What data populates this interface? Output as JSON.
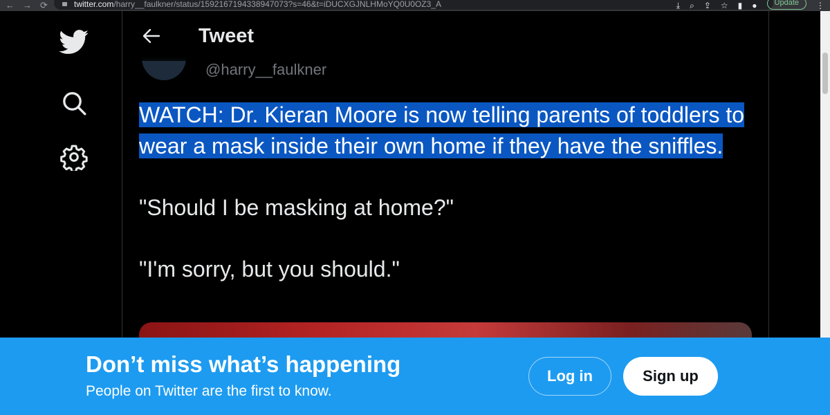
{
  "browser": {
    "url_host": "twitter.com",
    "url_path": "/harry__faulkner/status/1592167194338947073?s=46&t=iDUCXGJNLHMoYQ0U0OZ3_A",
    "update_label": "Update"
  },
  "nav": {
    "icons": [
      "twitter-logo-icon",
      "search-icon",
      "settings-icon"
    ]
  },
  "header": {
    "title": "Tweet"
  },
  "tweet": {
    "handle": "@harry__faulkner",
    "selected_text": "WATCH: Dr. Kieran Moore is now telling parents of toddlers to wear a mask inside their own home if they have the sniffles.",
    "quote_1": "\"Should I be masking at home?\"",
    "quote_2": "\"I'm sorry, but you should.\""
  },
  "banner": {
    "title": "Don’t miss what’s happening",
    "subtitle": "People on Twitter are the first to know.",
    "login_label": "Log in",
    "signup_label": "Sign up"
  },
  "colors": {
    "accent": "#1d9bf0",
    "selection": "#0a57c2",
    "background": "#000000"
  }
}
